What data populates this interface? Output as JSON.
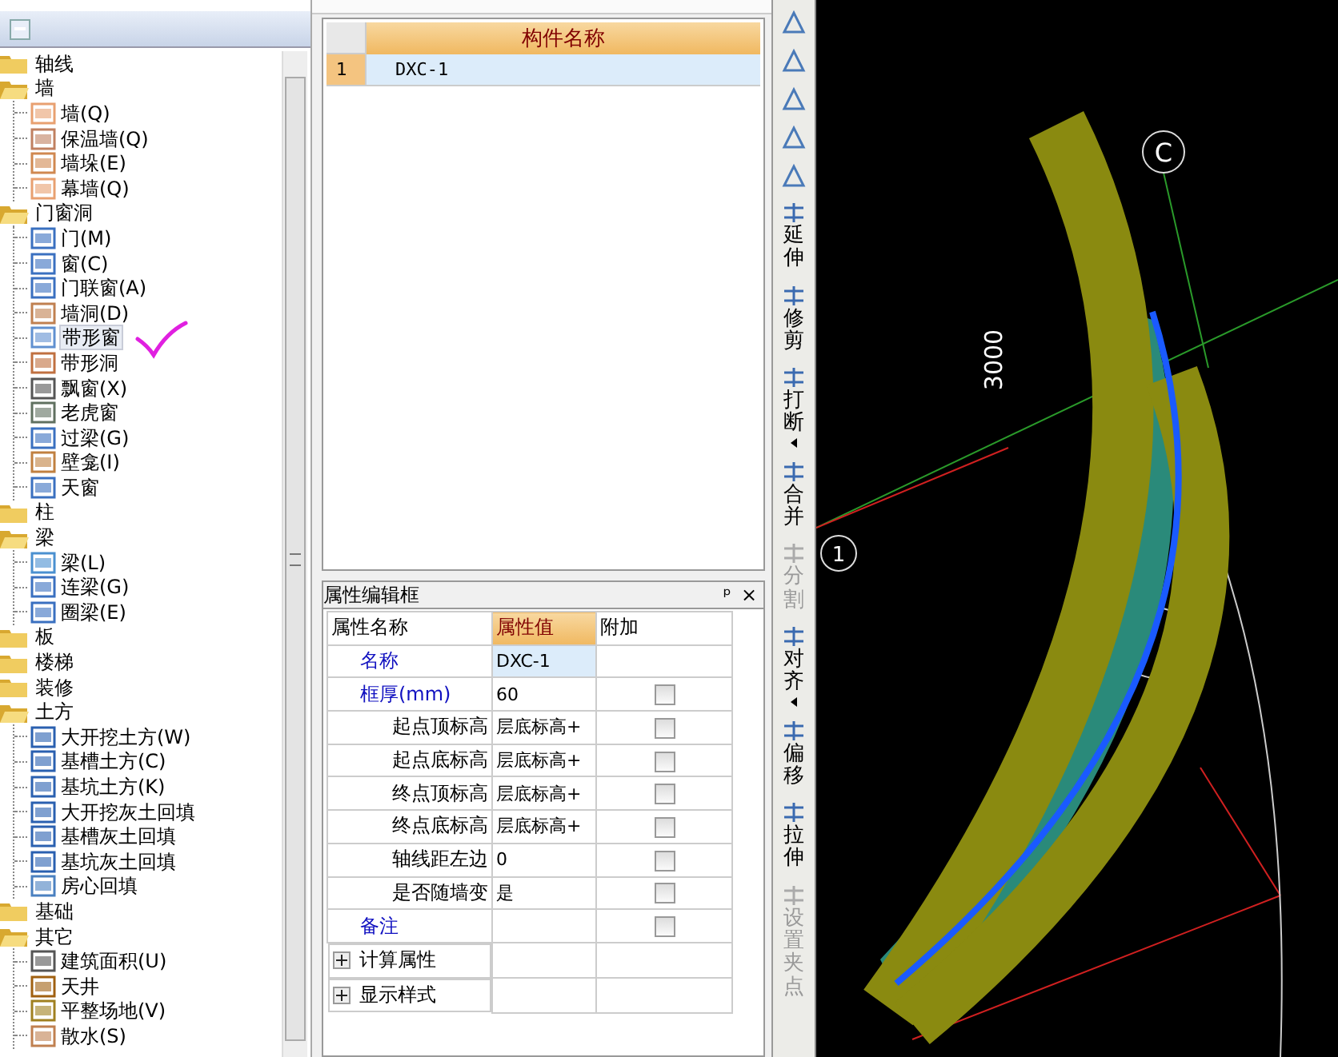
{
  "tree": [
    {
      "label": "轴线",
      "expanded": false
    },
    {
      "label": "墙",
      "expanded": true,
      "children": [
        {
          "label": "墙(Q)",
          "selected": false
        },
        {
          "label": "保温墙(Q)",
          "selected": false
        },
        {
          "label": "墙垛(E)",
          "selected": false
        },
        {
          "label": "幕墙(Q)",
          "selected": false
        }
      ]
    },
    {
      "label": "门窗洞",
      "expanded": true,
      "children": [
        {
          "label": "门(M)",
          "selected": false
        },
        {
          "label": "窗(C)",
          "selected": false
        },
        {
          "label": "门联窗(A)",
          "selected": false
        },
        {
          "label": "墙洞(D)",
          "selected": false
        },
        {
          "label": "带形窗",
          "selected": true
        },
        {
          "label": "带形洞",
          "selected": false
        },
        {
          "label": "飘窗(X)",
          "selected": false
        },
        {
          "label": "老虎窗",
          "selected": false
        },
        {
          "label": "过梁(G)",
          "selected": false
        },
        {
          "label": "壁龛(I)",
          "selected": false
        },
        {
          "label": "天窗",
          "selected": false
        }
      ]
    },
    {
      "label": "柱",
      "expanded": false
    },
    {
      "label": "梁",
      "expanded": true,
      "children": [
        {
          "label": "梁(L)",
          "selected": false
        },
        {
          "label": "连梁(G)",
          "selected": false
        },
        {
          "label": "圈梁(E)",
          "selected": false
        }
      ]
    },
    {
      "label": "板",
      "expanded": false
    },
    {
      "label": "楼梯",
      "expanded": false
    },
    {
      "label": "装修",
      "expanded": false
    },
    {
      "label": "土方",
      "expanded": true,
      "children": [
        {
          "label": "大开挖土方(W)",
          "selected": false
        },
        {
          "label": "基槽土方(C)",
          "selected": false
        },
        {
          "label": "基坑土方(K)",
          "selected": false
        },
        {
          "label": "大开挖灰土回填",
          "selected": false
        },
        {
          "label": "基槽灰土回填",
          "selected": false
        },
        {
          "label": "基坑灰土回填",
          "selected": false
        },
        {
          "label": "房心回填",
          "selected": false
        }
      ]
    },
    {
      "label": "基础",
      "expanded": false
    },
    {
      "label": "其它",
      "expanded": true,
      "children": [
        {
          "label": "建筑面积(U)",
          "selected": false
        },
        {
          "label": "天井",
          "selected": false
        },
        {
          "label": "平整场地(V)",
          "selected": false
        },
        {
          "label": "散水(S)",
          "selected": false
        }
      ]
    }
  ],
  "component_table": {
    "column": "构件名称",
    "rows": [
      {
        "index": "1",
        "name": "DXC-1",
        "selected": true
      }
    ]
  },
  "properties": {
    "title": "属性编辑框",
    "pin": "ᵖ",
    "close": "×",
    "columns": [
      "属性名称",
      "属性值",
      "附加"
    ],
    "rows": [
      {
        "kind": "prop",
        "name": "名称",
        "value": "DXC-1",
        "public": true,
        "selected": true
      },
      {
        "kind": "prop",
        "name": "框厚(mm)",
        "value": "60",
        "public": true,
        "checked": false,
        "selected": false
      },
      {
        "kind": "prop",
        "name": "起点顶标高",
        "value": "层底标高+",
        "public": false,
        "checked": false,
        "selected": false
      },
      {
        "kind": "prop",
        "name": "起点底标高",
        "value": "层底标高+",
        "public": false,
        "checked": false,
        "selected": false
      },
      {
        "kind": "prop",
        "name": "终点顶标高",
        "value": "层底标高+",
        "public": false,
        "checked": false,
        "selected": false
      },
      {
        "kind": "prop",
        "name": "终点底标高",
        "value": "层底标高+",
        "public": false,
        "checked": false,
        "selected": false
      },
      {
        "kind": "prop",
        "name": "轴线距左边",
        "value": "0",
        "public": false,
        "checked": false,
        "selected": false
      },
      {
        "kind": "prop",
        "name": "是否随墙变",
        "value": "是",
        "public": false,
        "checked": false,
        "selected": false
      },
      {
        "kind": "prop",
        "name": "备注",
        "public": true,
        "checked": false,
        "selected": false
      },
      {
        "kind": "group",
        "name": "计算属性",
        "expanded": false
      },
      {
        "kind": "group",
        "name": "显示样式",
        "expanded": false
      }
    ]
  },
  "toolbar": [
    {
      "kind": "icon"
    },
    {
      "kind": "icon"
    },
    {
      "kind": "icon"
    },
    {
      "kind": "icon"
    },
    {
      "kind": "icon"
    },
    {
      "kind": "labeled",
      "label": "延伸",
      "disabled": false,
      "menu": false
    },
    {
      "kind": "labeled",
      "label": "修剪",
      "disabled": false,
      "menu": false
    },
    {
      "kind": "labeled",
      "label": "打断",
      "disabled": false,
      "menu": true
    },
    {
      "kind": "labeled",
      "label": "合并",
      "disabled": false,
      "menu": false
    },
    {
      "kind": "labeled",
      "label": "分割",
      "disabled": true,
      "menu": false
    },
    {
      "kind": "labeled",
      "label": "对齐",
      "disabled": false,
      "menu": true
    },
    {
      "kind": "labeled",
      "label": "偏移",
      "disabled": false,
      "menu": false
    },
    {
      "kind": "labeled",
      "label": "拉伸",
      "disabled": false,
      "menu": false
    },
    {
      "kind": "labeled",
      "label": "设置夹点",
      "disabled": true,
      "menu": false
    }
  ],
  "canvas": {
    "axis_labels": [
      "C",
      "1"
    ],
    "dimension": "3000"
  }
}
